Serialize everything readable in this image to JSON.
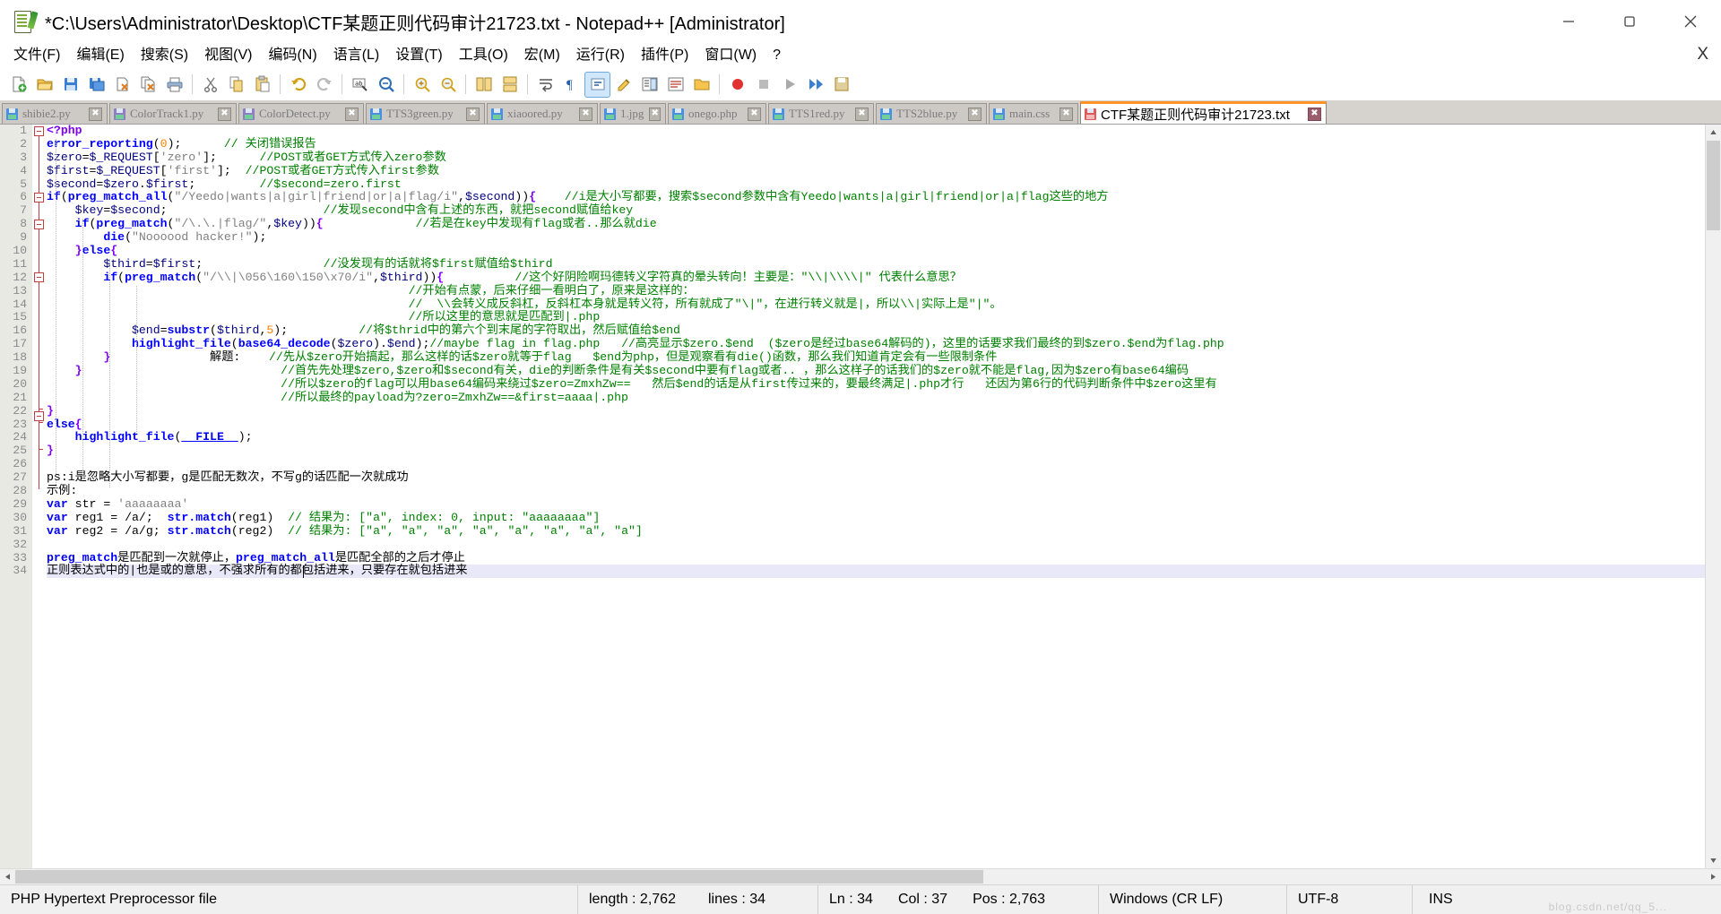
{
  "window": {
    "title": "*C:\\Users\\Administrator\\Desktop\\CTF某题正则代码审计21723.txt - Notepad++ [Administrator]",
    "minimize_label": "minimize",
    "restore_label": "restore",
    "close_label": "close"
  },
  "menu": {
    "items": [
      "文件(F)",
      "编辑(E)",
      "搜索(S)",
      "视图(V)",
      "编码(N)",
      "语言(L)",
      "设置(T)",
      "工具(O)",
      "宏(M)",
      "运行(R)",
      "插件(P)",
      "窗口(W)",
      "?"
    ],
    "close_doc": "X"
  },
  "toolbar": {
    "buttons": [
      "new-file",
      "open-file",
      "save-file",
      "save-all",
      "close-file",
      "close-all",
      "print",
      "cut",
      "copy",
      "paste",
      "undo",
      "redo",
      "find",
      "replace",
      "zoom-in",
      "zoom-out",
      "sync-vertical",
      "sync-horizontal",
      "word-wrap",
      "show-all-chars",
      "show-indent-guide",
      "user-defined-lang",
      "doc-map",
      "function-list",
      "folder-as-workspace",
      "start-record",
      "stop-record",
      "play-record",
      "fast-record",
      "save-record"
    ]
  },
  "tabs": {
    "items": [
      {
        "label": "shibie2.py",
        "icon": "floppy-blue",
        "modified": false,
        "active": false
      },
      {
        "label": "ColorTrack1.py",
        "icon": "floppy-purple",
        "modified": false,
        "active": false
      },
      {
        "label": "ColorDetect.py",
        "icon": "floppy-purple",
        "modified": false,
        "active": false
      },
      {
        "label": "TTS3green.py",
        "icon": "floppy-blue",
        "modified": false,
        "active": false
      },
      {
        "label": "xiaoored.py",
        "icon": "floppy-blue",
        "modified": false,
        "active": false
      },
      {
        "label": "1.jpg",
        "icon": "floppy-blue",
        "modified": false,
        "active": false
      },
      {
        "label": "onego.php",
        "icon": "floppy-blue",
        "modified": false,
        "active": false
      },
      {
        "label": "TTS1red.py",
        "icon": "floppy-blue",
        "modified": false,
        "active": false
      },
      {
        "label": "TTS2blue.py",
        "icon": "floppy-blue",
        "modified": false,
        "active": false
      },
      {
        "label": "main.css",
        "icon": "floppy-blue",
        "modified": false,
        "active": false
      },
      {
        "label": "CTF某题正则代码审计21723.txt",
        "icon": "floppy-red",
        "modified": true,
        "active": true
      }
    ],
    "close_glyph": "✖"
  },
  "editor": {
    "total_lines": 34,
    "line_numbers": [
      1,
      2,
      3,
      4,
      5,
      6,
      7,
      8,
      9,
      10,
      11,
      12,
      13,
      14,
      15,
      16,
      17,
      18,
      19,
      20,
      21,
      22,
      23,
      24,
      25,
      26,
      27,
      28,
      29,
      30,
      31,
      32,
      33,
      34
    ],
    "current_line": 34,
    "lines": [
      "<?php",
      "error_reporting(0);      // 关闭错误报告",
      "$zero=$_REQUEST['zero'];      //POST或者GET方式传入zero参数",
      "$first=$_REQUEST['first'];  //POST或者GET方式传入first参数",
      "$second=$zero.$first;         //$second=zero.first",
      "if(preg_match_all(\"/Yeedo|wants|a|girl|friend|or|a|flag/i\",$second)){    //i是大小写都要，搜索$second参数中含有Yeedo|wants|a|girl|friend|or|a|flag这些的地方",
      "    $key=$second;                      //发现second中含有上述的东西，就把second赋值给key",
      "    if(preg_match(\"/\\.\\.|flag/\",$key)){             //若是在key中发现有flag或者..那么就die",
      "        die(\"Noooood hacker!\");",
      "    }else{",
      "        $third=$first;                 //没发现有的话就将$first赋值给$third",
      "        if(preg_match(\"/\\\\|\\056\\160\\150\\x70/i\",$third)){          //这个好阴险啊玛德转义字符真的晕头转向！主要是：\"\\\\|\\\\\\\\|\" 代表什么意思？",
      "                                                   //开始有点蒙，后来仔细一看明白了，原来是这样的：",
      "                                                   //  \\\\会转义成反斜杠，反斜杠本身就是转义符，所有就成了\"\\|\"，在进行转义就是|，所以\\\\|实际上是\"|\"。",
      "                                                   //所以这里的意思就是匹配到|.php",
      "            $end=substr($third,5);          //将$thrid中的第六个到末尾的字符取出，然后赋值给$end",
      "            highlight_file(base64_decode($zero).$end);//maybe flag in flag.php   //高亮显示$zero.$end  ($zero是经过base64解码的)，这里的话要求我们最终的到$zero.$end为flag.php",
      "        }              解题:    //先从$zero开始搞起，那么这样的话$zero就等于flag   $end为php，但是观察看有die()函数，那么我们知道肯定会有一些限制条件",
      "    }                            //首先先处理$zero,$zero和$second有关，die的判断条件是有关$second中要有flag或者.. ，那么这样子的话我们的$zero就不能是flag,因为$zero有base64编码",
      "                                 //所以$zero的flag可以用base64编码来绕过$zero=ZmxhZw==   然后$end的话是从first传过来的，要最终满足|.php才行   还因为第6行的代码判断条件中$zero这里有",
      "                                 //所以最终的payload为?zero=ZmxhZw==&first=aaaa|.php",
      "}",
      "else{",
      "    highlight_file(__FILE__);",
      "}",
      "",
      "ps:i是忽略大小写都要，g是匹配无数次，不写g的话匹配一次就成功",
      "示例:",
      "var str = 'aaaaaaaa'",
      "var reg1 = /a/;  str.match(reg1)  // 结果为: [\"a\", index: 0, input: \"aaaaaaaa\"]",
      "var reg2 = /a/g; str.match(reg2)  // 结果为: [\"a\", \"a\", \"a\", \"a\", \"a\", \"a\", \"a\", \"a\"]",
      "",
      "preg_match是匹配到一次就停止，preg_match_all是匹配全部的之后才停止",
      "正则表达式中的|也是或的意思，不强求所有的都包括进来，只要存在就包括进来"
    ]
  },
  "status": {
    "file_type": "PHP Hypertext Preprocessor file",
    "length_label": "length : 2,762",
    "lines_label": "lines : 34",
    "ln_label": "Ln : 34",
    "col_label": "Col : 37",
    "pos_label": "Pos : 2,763",
    "eol_label": "Windows (CR LF)",
    "encoding_label": "UTF-8",
    "insert_label": "INS",
    "watermark": "blog.csdn.net/qq_5..."
  },
  "colors": {
    "accent_tab": "#ff9326",
    "keyword": "#0000ff",
    "comment": "#008000",
    "string": "#808080",
    "variable": "#000080",
    "number": "#ff8000",
    "operator": "#8000ff",
    "gutter_bg": "#e9e9e4",
    "tabbar_bg": "#d6d2ce",
    "current_line_bg": "#e8e8f8"
  }
}
